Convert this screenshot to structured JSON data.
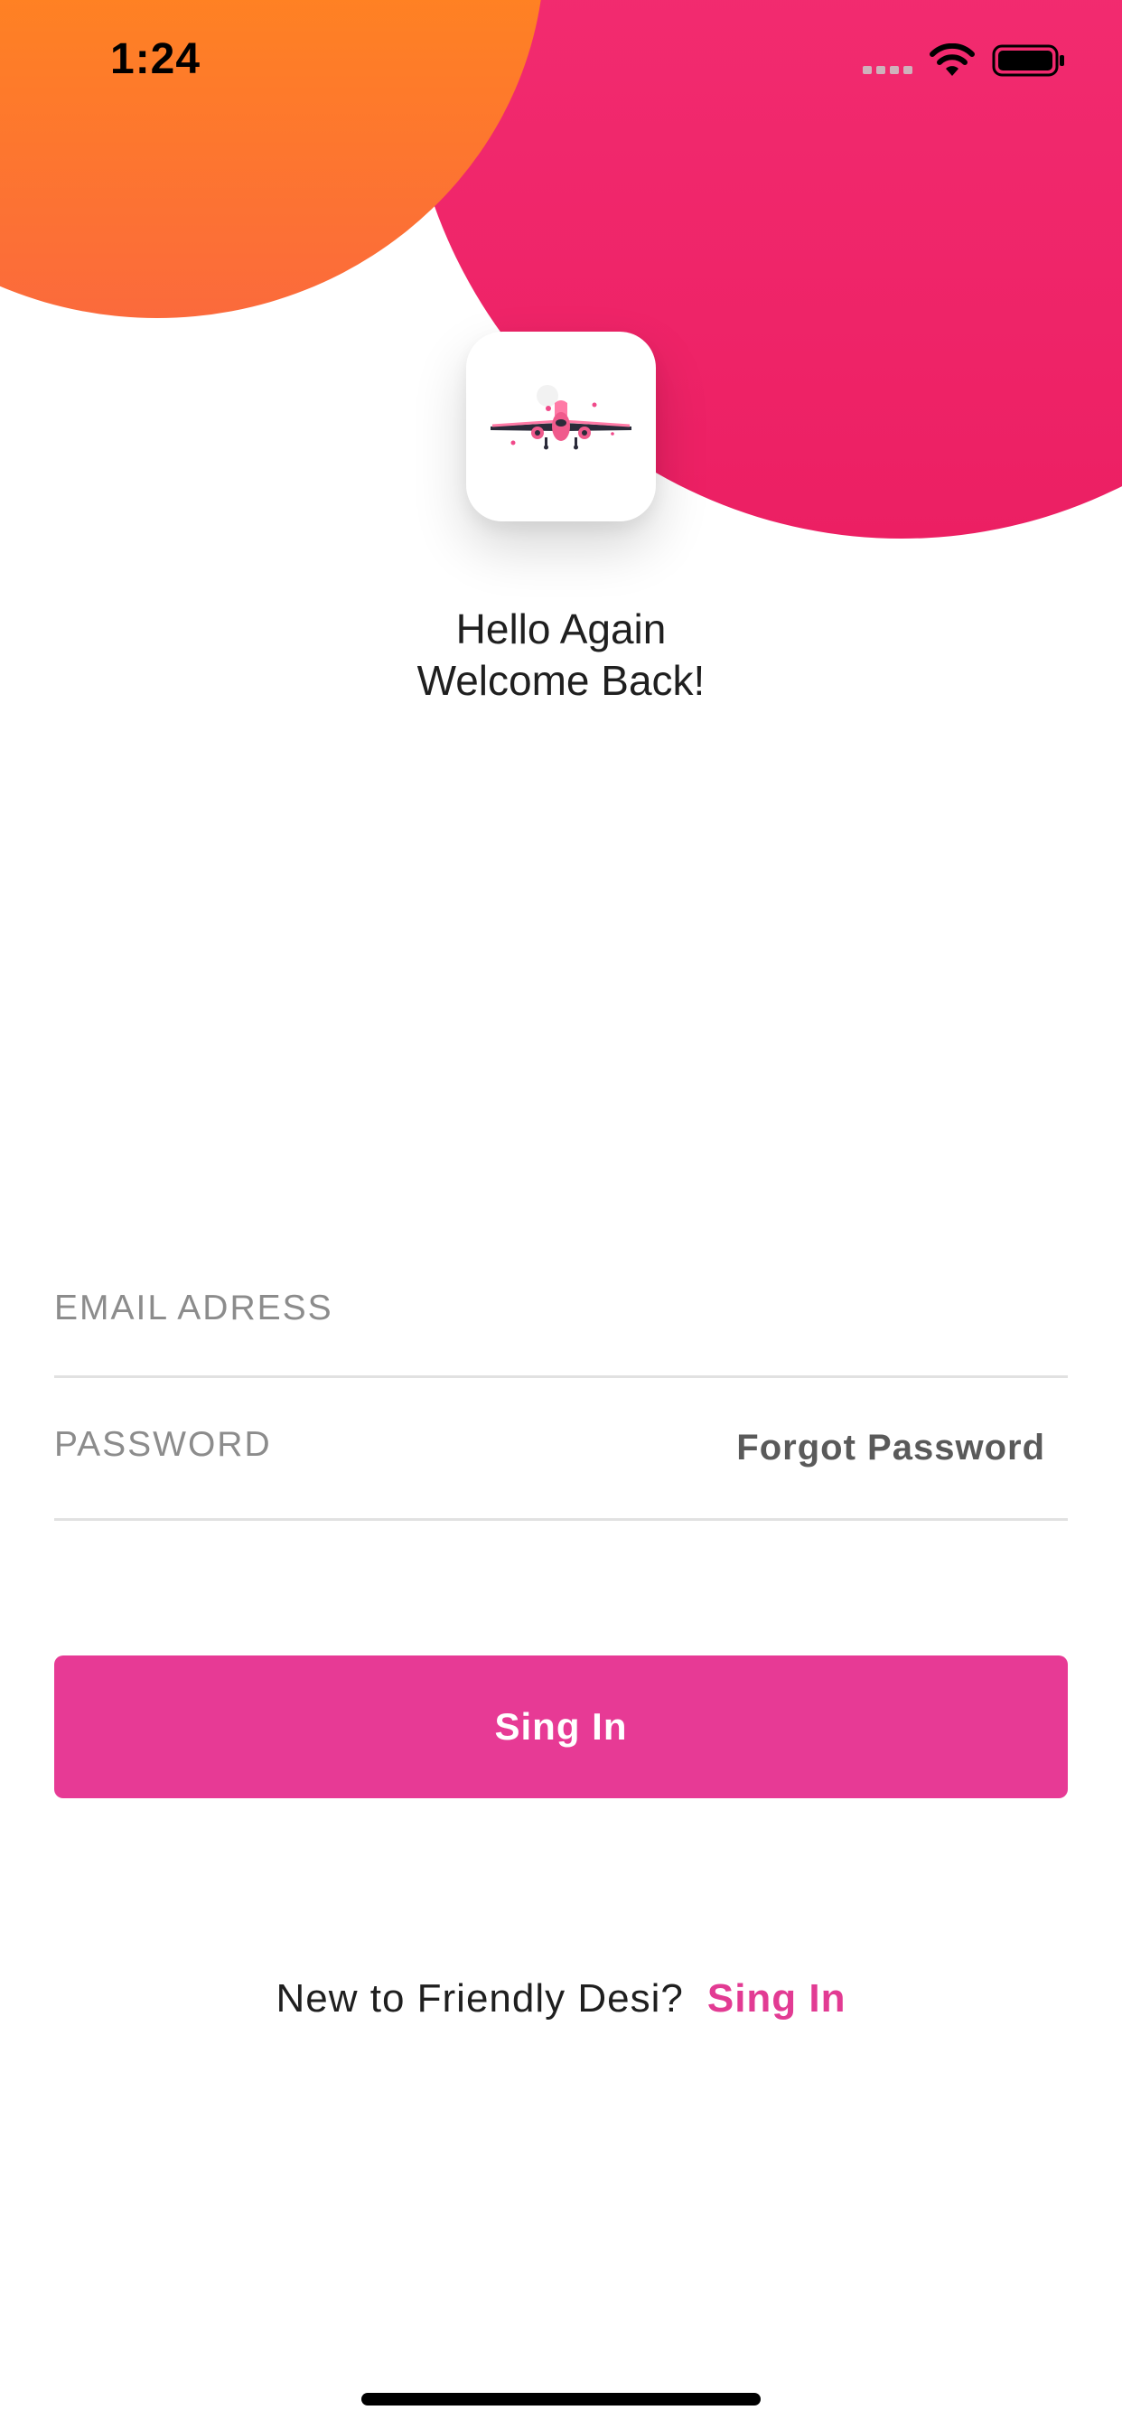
{
  "status_bar": {
    "time": "1:24"
  },
  "header": {
    "logo_icon": "airplane-icon",
    "greeting_line1": "Hello Again",
    "greeting_line2": "Welcome Back!"
  },
  "form": {
    "email_placeholder": "EMAIL ADRESS",
    "password_placeholder": "PASSWORD",
    "forgot_password_label": "Forgot Password",
    "submit_label": "Sing In"
  },
  "footer": {
    "prompt_text": "New to Friendly Desi?",
    "link_label": "Sing In"
  },
  "colors": {
    "accent": "#e73a95",
    "blob_pink": "#f0266a",
    "blob_orange": "#ff8222"
  }
}
